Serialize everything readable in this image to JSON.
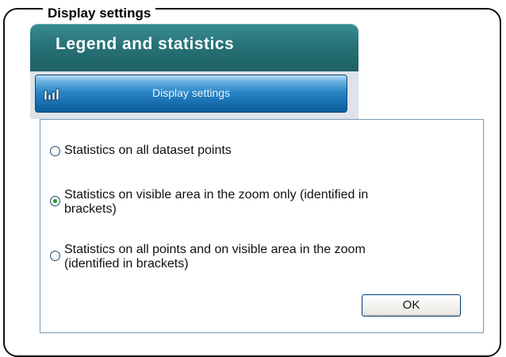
{
  "frame": {
    "title": "Display settings"
  },
  "panel": {
    "title": "Legend and statistics"
  },
  "tab": {
    "label": "Display settings",
    "icon": "bar-chart-icon"
  },
  "options": [
    {
      "label": "Statistics on all dataset points",
      "selected": false
    },
    {
      "label_line1": "Statistics on visible area in the zoom only (identified in",
      "label_line2": "brackets)",
      "selected": true
    },
    {
      "label_line1": "Statistics on all points and on visible area in the zoom",
      "label_line2": "(identified in brackets)",
      "selected": false
    }
  ],
  "ok_label": "OK",
  "colors": {
    "header_teal": "#277277",
    "tab_blue": "#2a86c7",
    "radio_selected": "#21a121"
  }
}
